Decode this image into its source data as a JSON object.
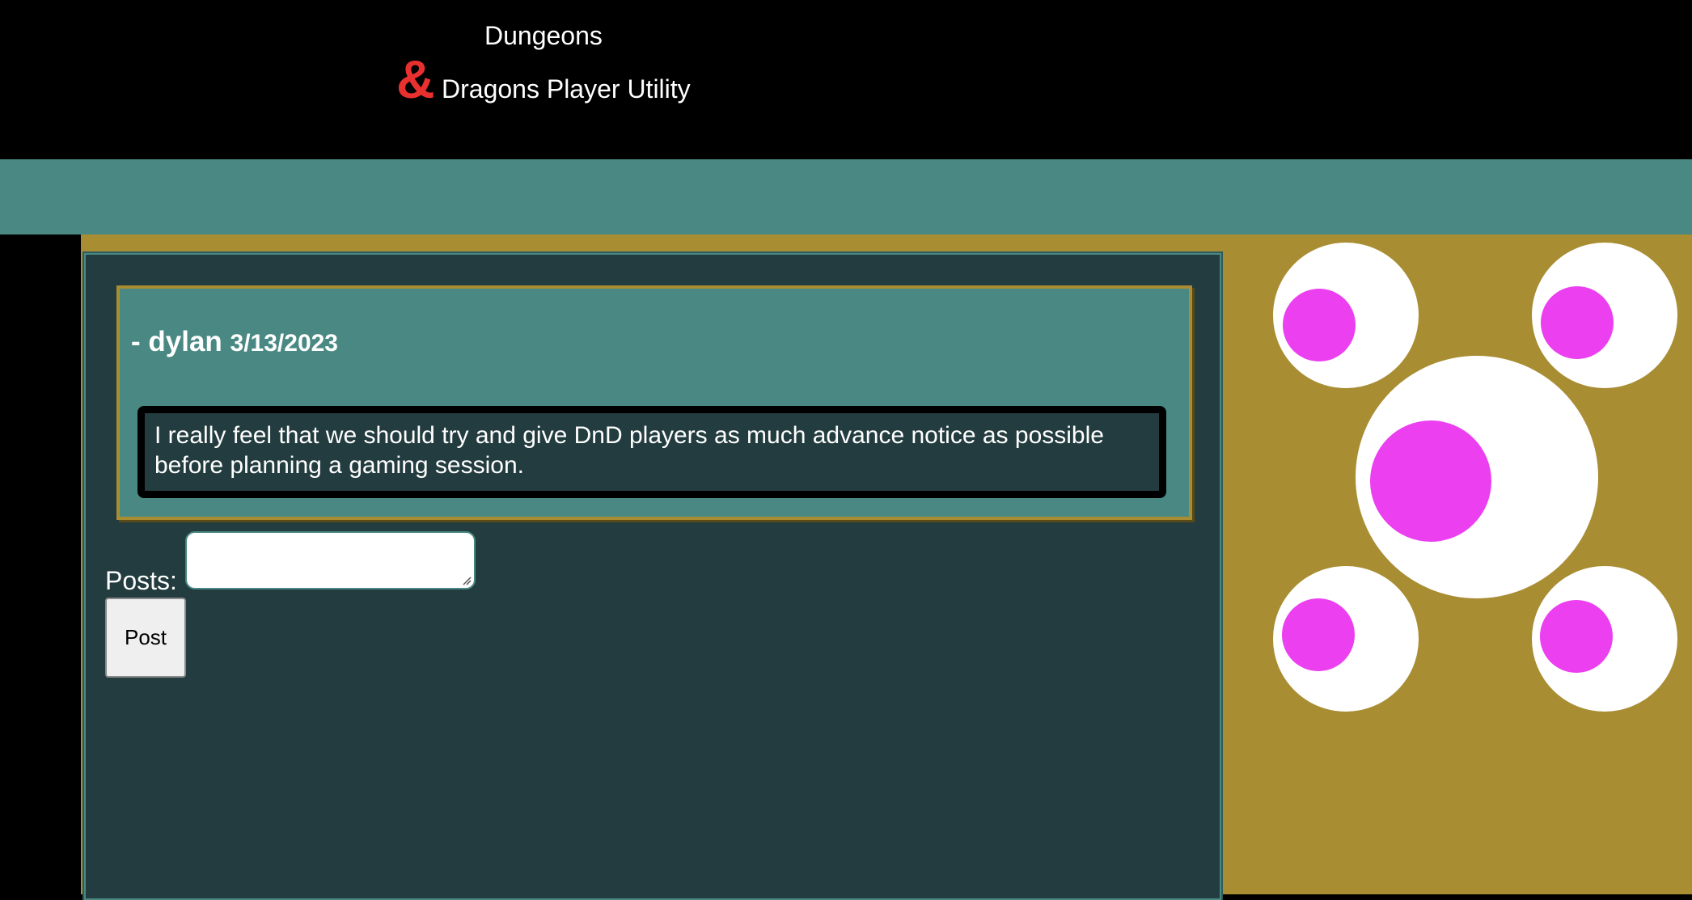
{
  "header": {
    "title_line1": "Dungeons",
    "title_ampersand": "&",
    "title_line2": "Dragons Player Utility"
  },
  "post": {
    "author": "- dylan",
    "date": "3/13/2023",
    "body": "I really feel that we should try and give DnD players as much advance notice as possible before planning a gaming session."
  },
  "form": {
    "posts_label": "Posts:",
    "input_value": "",
    "post_button_label": "Post"
  },
  "colors": {
    "teal": "#4a8983",
    "dark_panel": "#233c3f",
    "gold": "#a88d33",
    "ampersand_red": "#e8302e",
    "dot_magenta": "#eb3ff0"
  },
  "icons": {
    "logo": "dice-dots-logo"
  }
}
